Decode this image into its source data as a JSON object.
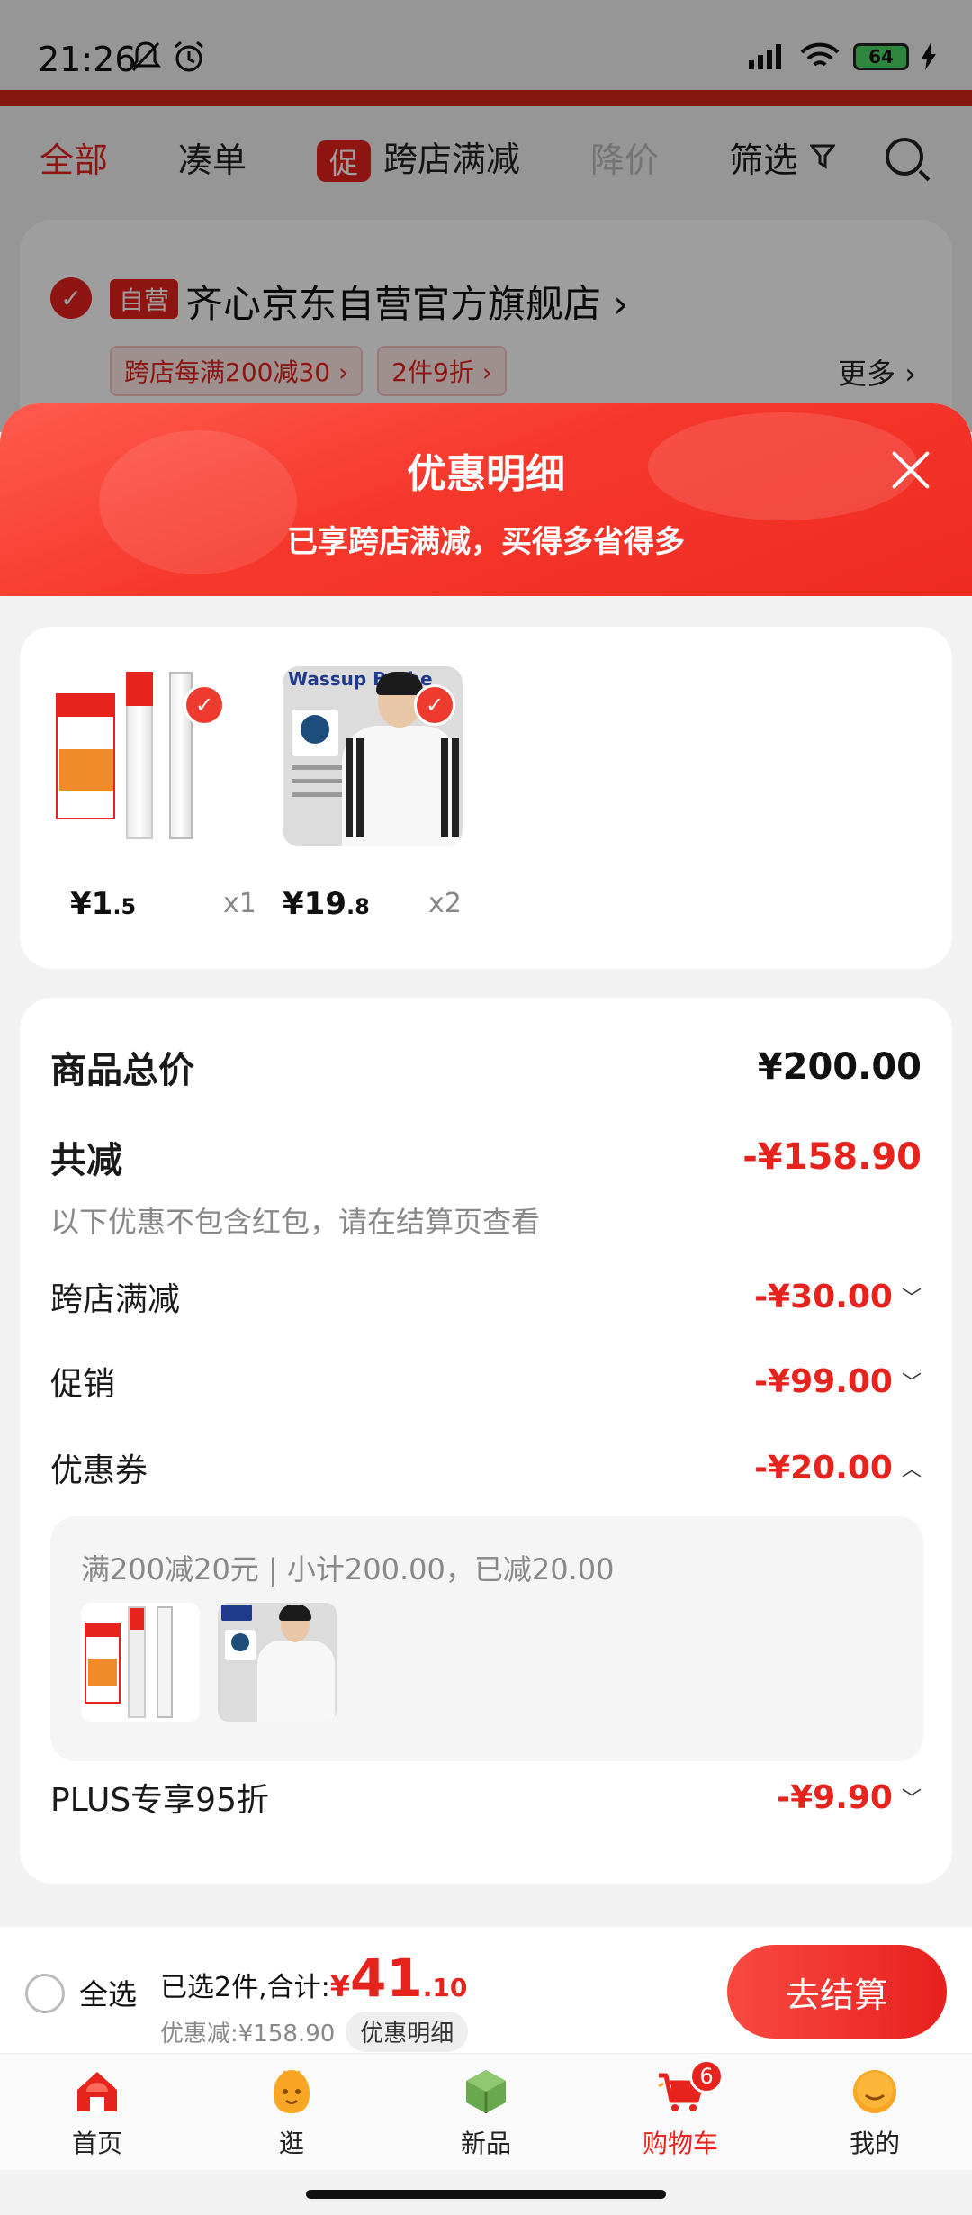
{
  "status": {
    "time": "21:26",
    "battery": "64"
  },
  "tabs": [
    {
      "label": "全部"
    },
    {
      "label": "凑单"
    },
    {
      "label": "跨店满减",
      "tag": "促"
    },
    {
      "label": "降价"
    },
    {
      "label": "筛选"
    }
  ],
  "store": {
    "tag": "自营",
    "name": "齐心京东自营官方旗舰店 ›",
    "promo1": "跨店每满200减30 ›",
    "promo2": "2件9折 ›",
    "more": "更多 ›"
  },
  "sheet": {
    "title": "优惠明细",
    "subtitle": "已享跨店满减，买得多省得多"
  },
  "products": [
    {
      "price_int": "¥1",
      "price_dec": ".5",
      "qty": "x1"
    },
    {
      "price_int": "¥19",
      "price_dec": ".8",
      "qty": "x2",
      "brand": "Wassup Bothe"
    }
  ],
  "details": {
    "total_label": "商品总价",
    "total_value": "¥200.00",
    "reduce_label": "共减",
    "reduce_value": "-¥158.90",
    "note": "以下优惠不包含红包，请在结算页查看",
    "rows": [
      {
        "label": "跨店满减",
        "value": "-¥30.00",
        "chev": "﹀"
      },
      {
        "label": "促销",
        "value": "-¥99.00",
        "chev": "﹀"
      },
      {
        "label": "优惠券",
        "value": "-¥20.00",
        "chev": "︿"
      }
    ],
    "coupon_text": "满200减20元 | 小计200.00，已减20.00",
    "plus_label": "PLUS专享95折",
    "plus_value": "-¥9.90",
    "plus_chev": "﹀"
  },
  "checkout": {
    "select_all": "全选",
    "summary_prefix": "已选2件,合计:",
    "yen": "¥",
    "amount_int": "41",
    "amount_dec": ".10",
    "discount": "优惠减:¥158.90",
    "detail_btn": "优惠明细",
    "button": "去结算"
  },
  "nav": [
    {
      "label": "首页"
    },
    {
      "label": "逛"
    },
    {
      "label": "新品"
    },
    {
      "label": "购物车",
      "badge": "6"
    },
    {
      "label": "我的"
    }
  ],
  "colors": {
    "brand_red": "#e6231d",
    "sheet_header": "#f6382c"
  }
}
